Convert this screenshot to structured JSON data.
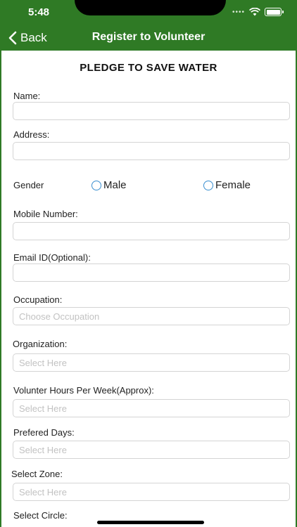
{
  "status_bar": {
    "time": "5:48"
  },
  "nav": {
    "back_label": "Back",
    "title": "Register to Volunteer"
  },
  "form": {
    "title": "PLEDGE TO SAVE WATER",
    "name_label": "Name:",
    "address_label": "Address:",
    "gender_label": "Gender",
    "gender_options": [
      "Male",
      "Female"
    ],
    "mobile_label": "Mobile Number:",
    "email_label": "Email ID(Optional):",
    "occupation_label": "Occupation:",
    "occupation_placeholder": "Choose Occupation",
    "organization_label": "Organization:",
    "organization_placeholder": "Select Here",
    "hours_label": "Volunter Hours Per Week(Approx):",
    "hours_placeholder": "Select Here",
    "days_label": "Prefered Days:",
    "days_placeholder": "Select Here",
    "zone_label": "Select Zone:",
    "zone_placeholder": "Select Here",
    "circle_label": "Select Circle:"
  },
  "colors": {
    "header_green": "#2f7a25",
    "radio_blue": "#3a8fd0"
  }
}
